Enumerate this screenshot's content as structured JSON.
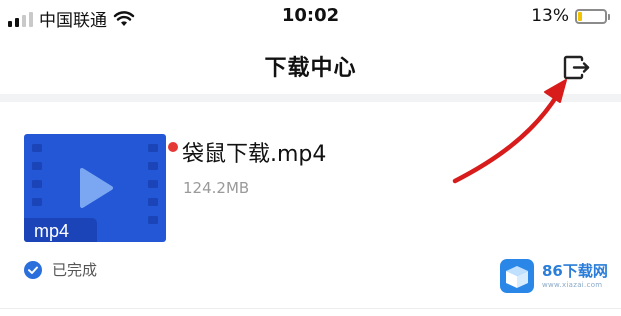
{
  "status_bar": {
    "carrier": "中国联通",
    "time": "10:02",
    "battery_percent": "13%",
    "battery_level": 0.13
  },
  "nav": {
    "title": "下载中心",
    "export_icon": "export-icon"
  },
  "download": {
    "file_name": "袋鼠下载.mp4",
    "file_size": "124.2MB",
    "thumb_label": "mp4",
    "status": "已完成",
    "status_icon": "check-circle-icon",
    "unread_dot_color": "#e53935"
  },
  "watermark": {
    "brand": "86下载网",
    "url": "www.xiazai.com"
  },
  "colors": {
    "accent": "#2a6fdb",
    "thumb_blue": "#2357d6",
    "annotation_arrow": "#d81b1b"
  }
}
